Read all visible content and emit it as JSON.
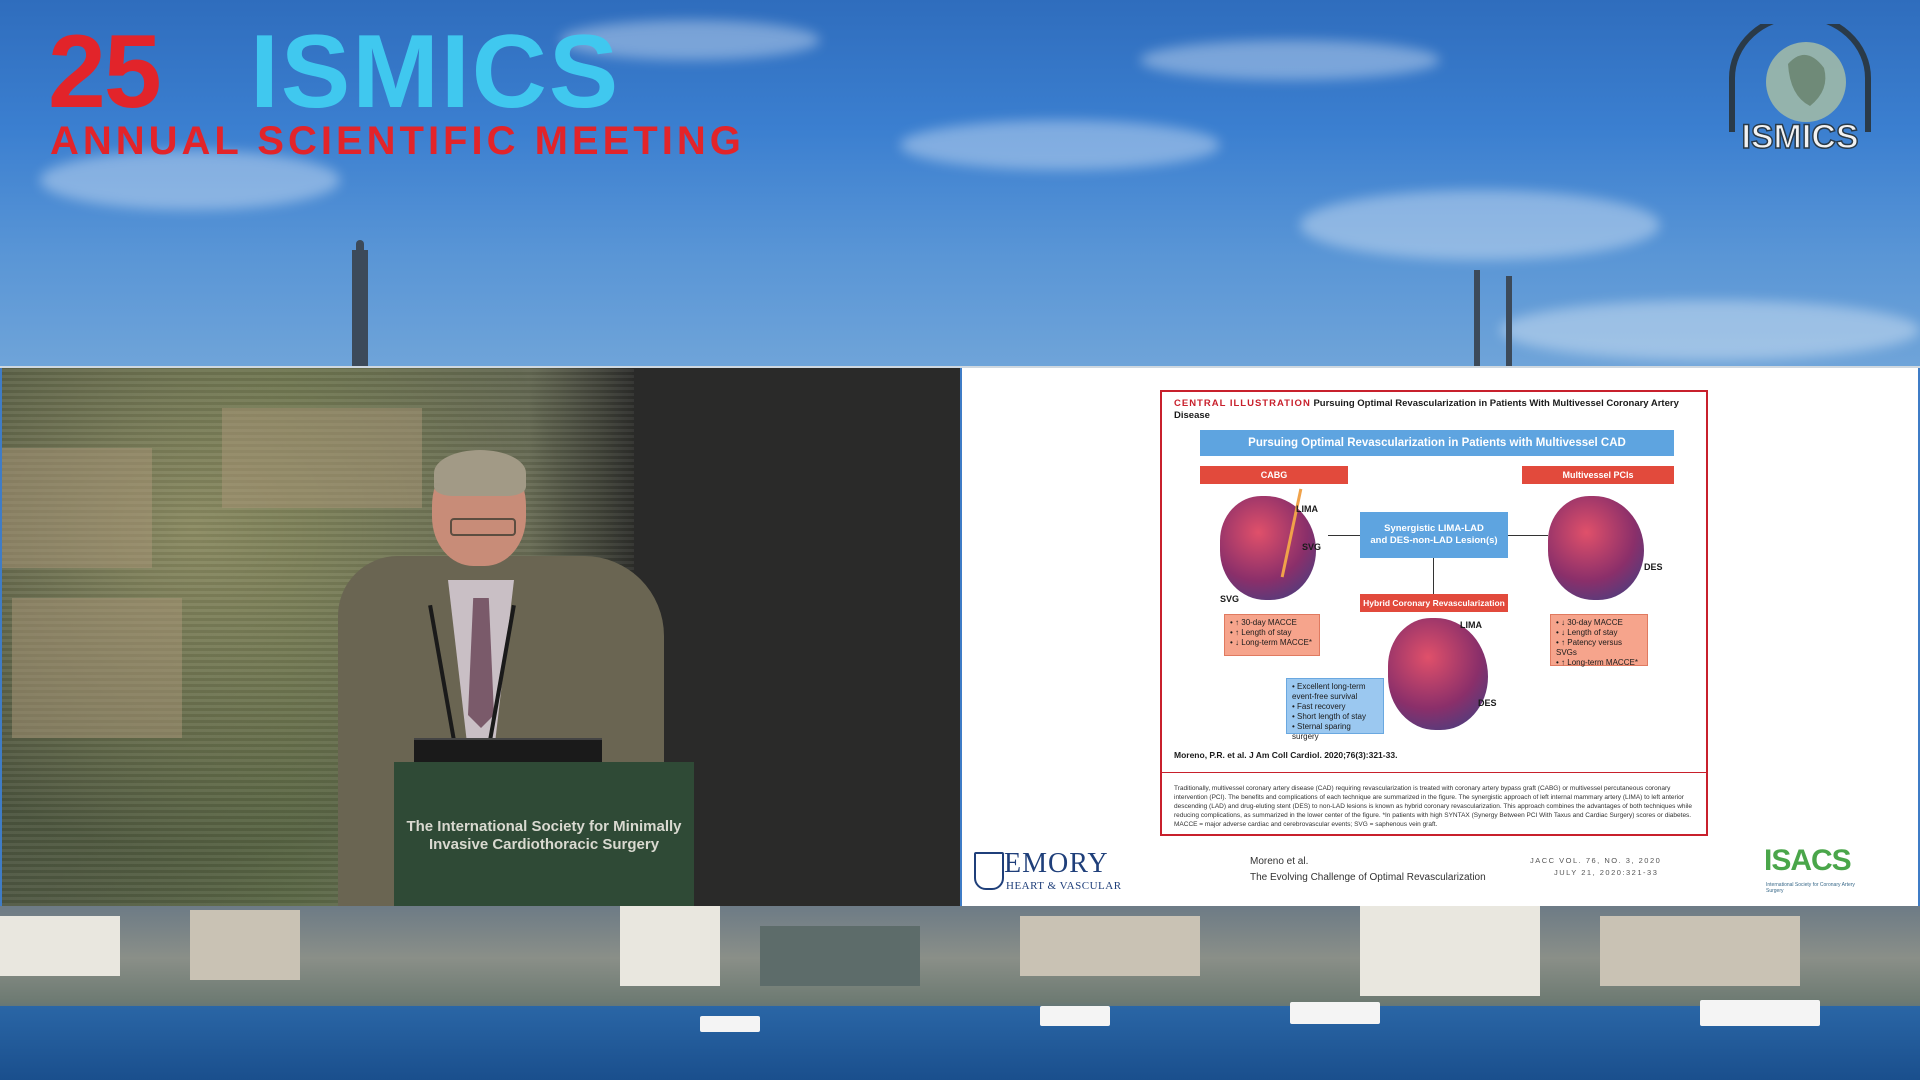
{
  "header": {
    "number": "25",
    "brand": "ISMICS",
    "subtitle": "ANNUAL SCIENTIFIC MEETING",
    "logo_text": "ISMICS"
  },
  "video": {
    "podium_label": "The International Society for Minimally Invasive Cardiothoracic Surgery"
  },
  "slide": {
    "ci_label": "CENTRAL ILLUSTRATION",
    "ci_title": "Pursuing Optimal Revascularization in Patients With Multivessel Coronary Artery Disease",
    "banner": "Pursuing Optimal Revascularization in Patients with Multivessel CAD",
    "left_header": "CABG",
    "right_header": "Multivessel PCIs",
    "center_box_line1": "Synergistic LIMA-LAD",
    "center_box_line2": "and DES-non-LAD Lesion(s)",
    "hybrid_header": "Hybrid Coronary Revascularization",
    "labels": {
      "lima_left": "LIMA",
      "svg_left_1": "SVG",
      "svg_left_2": "SVG",
      "des_right": "DES",
      "lima_center": "LIMA",
      "des_center": "DES"
    },
    "cabg_notes": [
      "• ↑ 30-day MACCE",
      "• ↑ Length of stay",
      "• ↓ Long-term MACCE*"
    ],
    "pci_notes": [
      "• ↓ 30-day MACCE",
      "• ↓ Length of stay",
      "• ↑ Patency versus SVGs",
      "• ↑ Long-term MACCE*"
    ],
    "hybrid_notes": [
      "• Excellent long-term",
      "   event-free survival",
      "• Fast recovery",
      "• Short length of stay",
      "• Sternal sparing surgery"
    ],
    "citation": "Moreno, P.R. et al. J Am Coll Cardiol. 2020;76(3):321-33.",
    "caption": "Traditionally, multivessel coronary artery disease (CAD) requiring revascularization is treated with coronary artery bypass graft (CABG) or multivessel percutaneous coronary intervention (PCI). The benefits and complications of each technique are summarized in the figure. The synergistic approach of left internal mammary artery (LIMA) to left anterior descending (LAD) and drug-eluting stent (DES) to non-LAD lesions is known as hybrid coronary revascularization. This approach combines the advantages of both techniques while reducing complications, as summarized in the lower center of the figure. *In patients with high SYNTAX (Synergy Between PCI With Taxus and Cardiac Surgery) scores or diabetes. MACCE = major adverse cardiac and cerebrovascular events; SVG = saphenous vein graft.",
    "footer": {
      "emory_name": "EMORY",
      "emory_sub": "HEART & VASCULAR",
      "ref_author": "Moreno et al.",
      "ref_title": "The Evolving Challenge of Optimal Revascularization",
      "journal_line1": "JACC VOL. 76, NO. 3, 2020",
      "journal_line2": "JULY 21, 2020:321-33",
      "isacs_name": "ISACS",
      "isacs_sub": "International Society for Coronary Artery Surgery"
    }
  },
  "colors": {
    "brand_red": "#e2242a",
    "brand_cyan": "#40c8ef",
    "ci_red": "#c8202c",
    "ci_blue": "#5ea4e0"
  }
}
